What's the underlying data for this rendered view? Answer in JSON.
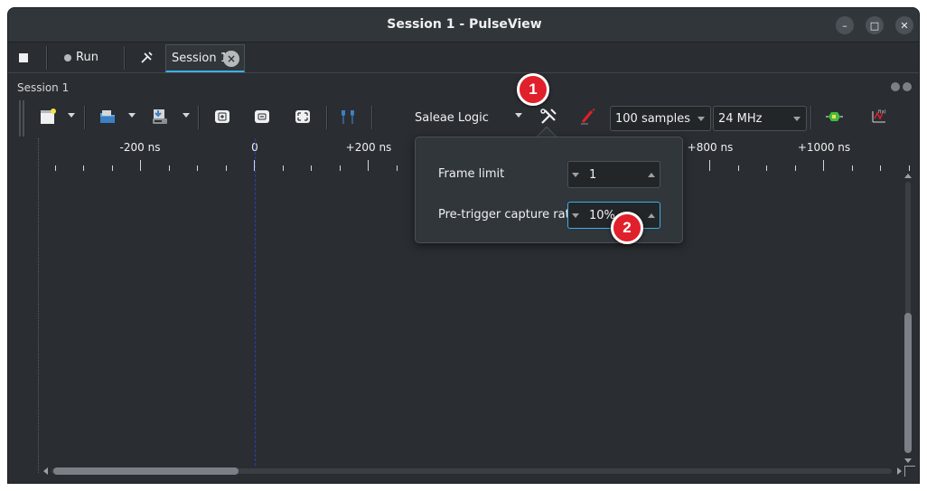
{
  "window": {
    "title": "Session 1 - PulseView",
    "controls": {
      "minimize": "–",
      "maximize": "□",
      "close": "✕"
    }
  },
  "tabs": {
    "run_label": "Run",
    "session_tab_label": "Session 1",
    "close_glyph": "×"
  },
  "dock": {
    "title": "Session 1"
  },
  "toolbar": {
    "device": "Saleae Logic",
    "samples": "100  samples",
    "samplerate": "24 MHz"
  },
  "ruler": {
    "labels": [
      "-200 ns",
      "0",
      "+200 ns",
      "+800 ns",
      "+1000 ns"
    ]
  },
  "popup": {
    "frame_limit_label": "Frame limit",
    "frame_limit_value": "1",
    "pretrigger_label": "Pre-trigger capture ratio",
    "pretrigger_value": "10%"
  },
  "callouts": [
    "1",
    "2"
  ],
  "colors": {
    "accent": "#3daee9",
    "background": "#2a2e32",
    "callout": "#e0202a"
  },
  "icons": [
    "stop-icon",
    "record-dot-icon",
    "tools-icon",
    "new-session-icon",
    "open-folder-icon",
    "save-icon",
    "zoom-in-icon",
    "zoom-out-icon",
    "zoom-fit-icon",
    "cursor-icon",
    "device-config-icon",
    "probe-icon",
    "decoder-icon",
    "math-icon"
  ]
}
